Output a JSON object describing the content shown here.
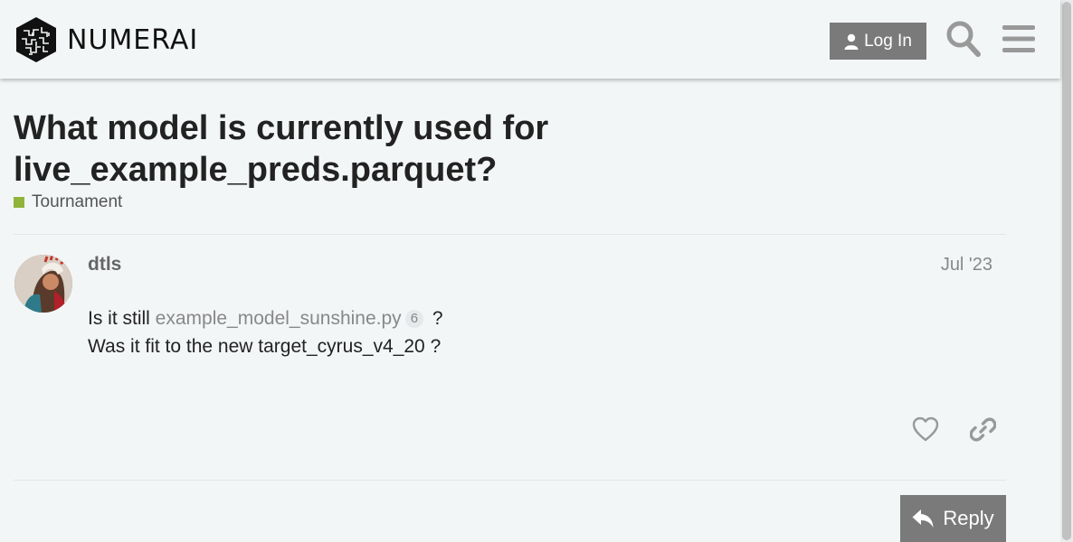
{
  "header": {
    "logo_text": "NUMERAI",
    "login_label": "Log In",
    "icons": {
      "user": "user-icon",
      "search": "search-icon",
      "menu": "hamburger-menu-icon"
    }
  },
  "topic": {
    "title_line1": "What model is currently used for",
    "title_line2": "live_example_preds.parquet?",
    "category": "Tournament",
    "category_color": "#8fb43a"
  },
  "post": {
    "username": "dtls",
    "date": "Jul '23",
    "line1_prefix": "Is it still ",
    "link_text": "example_model_sunshine.py",
    "link_clicks": "6",
    "line1_suffix": " ?",
    "line2": "Was it fit to the new target_cyrus_v4_20 ?",
    "icons": {
      "like": "heart-icon",
      "share": "link-icon"
    }
  },
  "footer": {
    "reply_label": "Reply",
    "reply_icon": "reply-arrow-icon"
  }
}
